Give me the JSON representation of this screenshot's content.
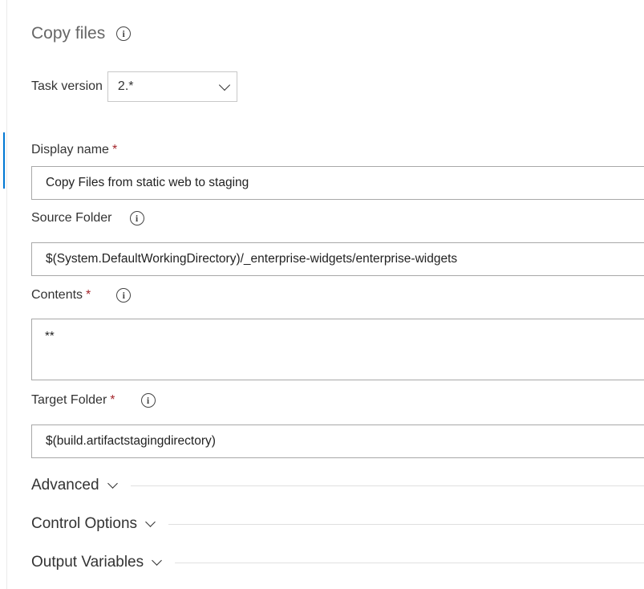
{
  "task": {
    "title": "Copy files"
  },
  "version": {
    "label": "Task version",
    "value": "2.*"
  },
  "fields": {
    "display_name": {
      "label": "Display name",
      "required_mark": "*",
      "value": "Copy Files from static web to staging"
    },
    "source_folder": {
      "label": "Source Folder",
      "value": "$(System.DefaultWorkingDirectory)/_enterprise-widgets/enterprise-widgets"
    },
    "contents": {
      "label": "Contents",
      "required_mark": "*",
      "value": "**"
    },
    "target_folder": {
      "label": "Target Folder",
      "required_mark": "*",
      "value": "$(build.artifactstagingdirectory)"
    }
  },
  "sections": {
    "advanced": "Advanced",
    "control_options": "Control Options",
    "output_variables": "Output Variables"
  },
  "icons": {
    "info": "info-icon",
    "chevron": "chevron-down-icon"
  },
  "colors": {
    "required": "#a4262c",
    "accent": "#0078d4"
  }
}
